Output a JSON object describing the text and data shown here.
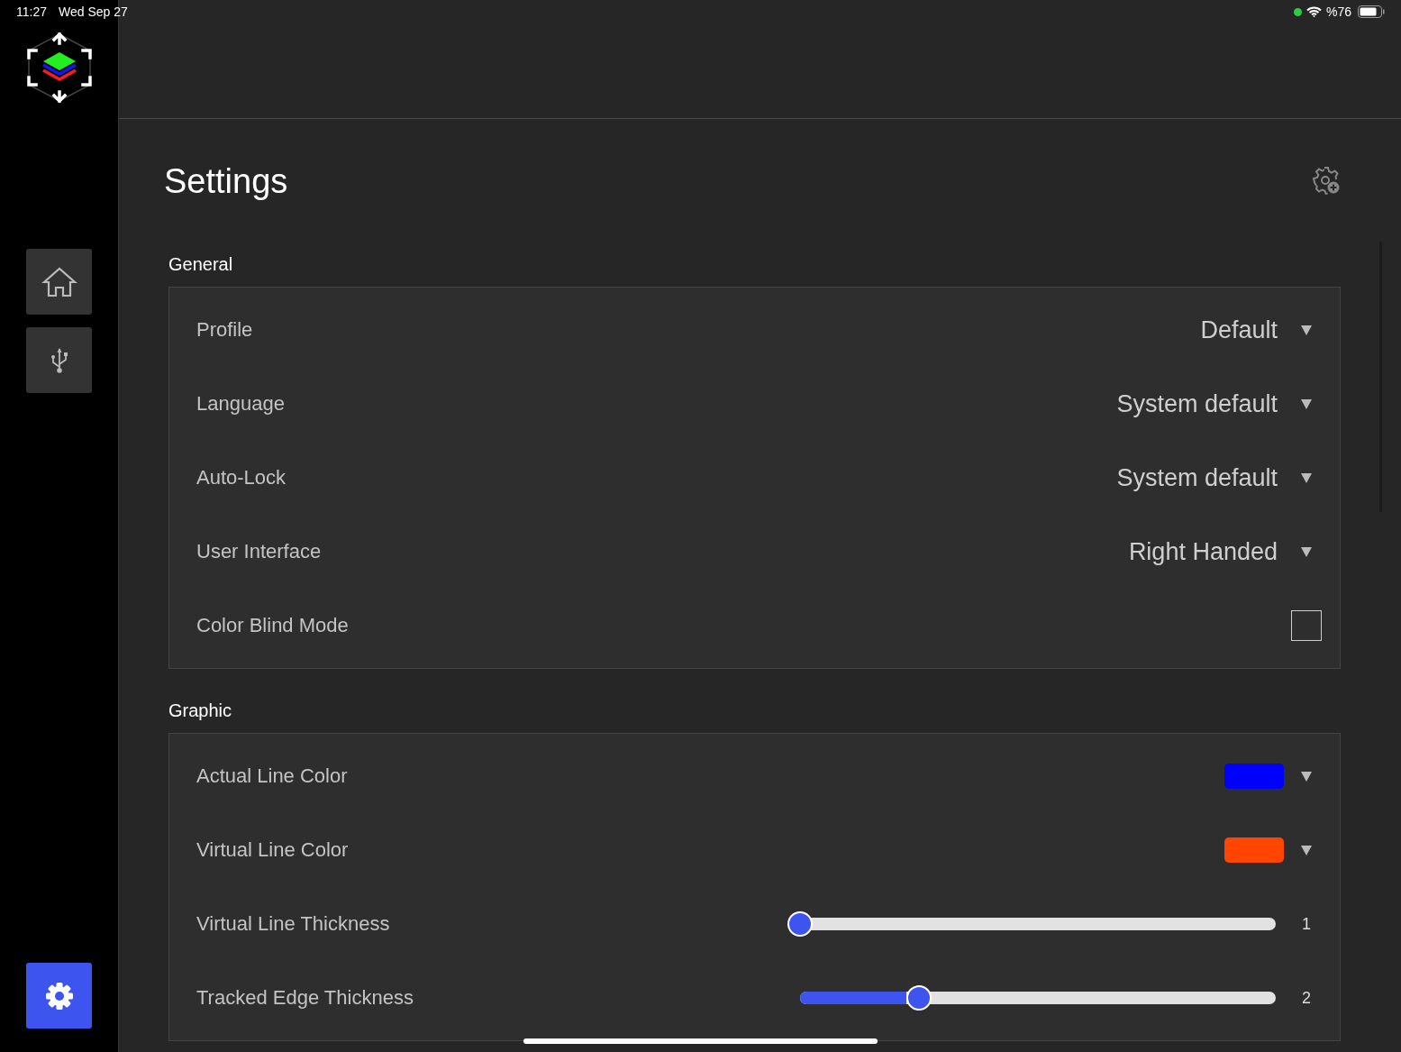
{
  "status_bar": {
    "time": "11:27",
    "date": "Wed Sep 27",
    "battery": "%76"
  },
  "sidebar": {
    "items": [
      {
        "kind": "home",
        "selected": false
      },
      {
        "kind": "usb",
        "selected": false
      },
      {
        "kind": "settings",
        "selected": true
      }
    ]
  },
  "title": "Settings",
  "sections": [
    {
      "title": "General",
      "rows": [
        {
          "kind": "dropdown",
          "label": "Profile",
          "value": "Default"
        },
        {
          "kind": "dropdown",
          "label": "Language",
          "value": "System default"
        },
        {
          "kind": "dropdown",
          "label": "Auto-Lock",
          "value": "System default"
        },
        {
          "kind": "dropdown",
          "label": "User Interface",
          "value": "Right Handed"
        },
        {
          "kind": "checkbox",
          "label": "Color Blind Mode",
          "checked": false
        }
      ]
    },
    {
      "title": "Graphic",
      "rows": [
        {
          "kind": "color",
          "label": "Actual Line Color",
          "color": "#0000ff"
        },
        {
          "kind": "color",
          "label": "Virtual Line Color",
          "color": "#ff4500"
        },
        {
          "kind": "slider",
          "label": "Virtual Line Thickness",
          "level": 0,
          "reading": "1"
        },
        {
          "kind": "slider",
          "label": "Tracked Edge Thickness",
          "level": 0.25,
          "reading": "2"
        }
      ]
    }
  ]
}
